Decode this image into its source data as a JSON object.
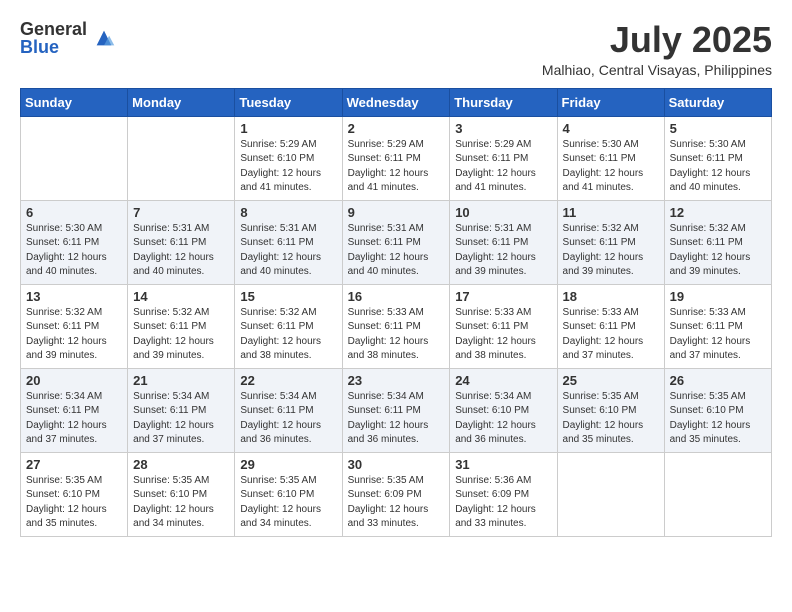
{
  "logo": {
    "general": "General",
    "blue": "Blue"
  },
  "title": {
    "month_year": "July 2025",
    "location": "Malhiao, Central Visayas, Philippines"
  },
  "weekdays": [
    "Sunday",
    "Monday",
    "Tuesday",
    "Wednesday",
    "Thursday",
    "Friday",
    "Saturday"
  ],
  "weeks": [
    [
      {
        "day": "",
        "info": ""
      },
      {
        "day": "",
        "info": ""
      },
      {
        "day": "1",
        "info": "Sunrise: 5:29 AM\nSunset: 6:10 PM\nDaylight: 12 hours and 41 minutes."
      },
      {
        "day": "2",
        "info": "Sunrise: 5:29 AM\nSunset: 6:11 PM\nDaylight: 12 hours and 41 minutes."
      },
      {
        "day": "3",
        "info": "Sunrise: 5:29 AM\nSunset: 6:11 PM\nDaylight: 12 hours and 41 minutes."
      },
      {
        "day": "4",
        "info": "Sunrise: 5:30 AM\nSunset: 6:11 PM\nDaylight: 12 hours and 41 minutes."
      },
      {
        "day": "5",
        "info": "Sunrise: 5:30 AM\nSunset: 6:11 PM\nDaylight: 12 hours and 40 minutes."
      }
    ],
    [
      {
        "day": "6",
        "info": "Sunrise: 5:30 AM\nSunset: 6:11 PM\nDaylight: 12 hours and 40 minutes."
      },
      {
        "day": "7",
        "info": "Sunrise: 5:31 AM\nSunset: 6:11 PM\nDaylight: 12 hours and 40 minutes."
      },
      {
        "day": "8",
        "info": "Sunrise: 5:31 AM\nSunset: 6:11 PM\nDaylight: 12 hours and 40 minutes."
      },
      {
        "day": "9",
        "info": "Sunrise: 5:31 AM\nSunset: 6:11 PM\nDaylight: 12 hours and 40 minutes."
      },
      {
        "day": "10",
        "info": "Sunrise: 5:31 AM\nSunset: 6:11 PM\nDaylight: 12 hours and 39 minutes."
      },
      {
        "day": "11",
        "info": "Sunrise: 5:32 AM\nSunset: 6:11 PM\nDaylight: 12 hours and 39 minutes."
      },
      {
        "day": "12",
        "info": "Sunrise: 5:32 AM\nSunset: 6:11 PM\nDaylight: 12 hours and 39 minutes."
      }
    ],
    [
      {
        "day": "13",
        "info": "Sunrise: 5:32 AM\nSunset: 6:11 PM\nDaylight: 12 hours and 39 minutes."
      },
      {
        "day": "14",
        "info": "Sunrise: 5:32 AM\nSunset: 6:11 PM\nDaylight: 12 hours and 39 minutes."
      },
      {
        "day": "15",
        "info": "Sunrise: 5:32 AM\nSunset: 6:11 PM\nDaylight: 12 hours and 38 minutes."
      },
      {
        "day": "16",
        "info": "Sunrise: 5:33 AM\nSunset: 6:11 PM\nDaylight: 12 hours and 38 minutes."
      },
      {
        "day": "17",
        "info": "Sunrise: 5:33 AM\nSunset: 6:11 PM\nDaylight: 12 hours and 38 minutes."
      },
      {
        "day": "18",
        "info": "Sunrise: 5:33 AM\nSunset: 6:11 PM\nDaylight: 12 hours and 37 minutes."
      },
      {
        "day": "19",
        "info": "Sunrise: 5:33 AM\nSunset: 6:11 PM\nDaylight: 12 hours and 37 minutes."
      }
    ],
    [
      {
        "day": "20",
        "info": "Sunrise: 5:34 AM\nSunset: 6:11 PM\nDaylight: 12 hours and 37 minutes."
      },
      {
        "day": "21",
        "info": "Sunrise: 5:34 AM\nSunset: 6:11 PM\nDaylight: 12 hours and 37 minutes."
      },
      {
        "day": "22",
        "info": "Sunrise: 5:34 AM\nSunset: 6:11 PM\nDaylight: 12 hours and 36 minutes."
      },
      {
        "day": "23",
        "info": "Sunrise: 5:34 AM\nSunset: 6:11 PM\nDaylight: 12 hours and 36 minutes."
      },
      {
        "day": "24",
        "info": "Sunrise: 5:34 AM\nSunset: 6:10 PM\nDaylight: 12 hours and 36 minutes."
      },
      {
        "day": "25",
        "info": "Sunrise: 5:35 AM\nSunset: 6:10 PM\nDaylight: 12 hours and 35 minutes."
      },
      {
        "day": "26",
        "info": "Sunrise: 5:35 AM\nSunset: 6:10 PM\nDaylight: 12 hours and 35 minutes."
      }
    ],
    [
      {
        "day": "27",
        "info": "Sunrise: 5:35 AM\nSunset: 6:10 PM\nDaylight: 12 hours and 35 minutes."
      },
      {
        "day": "28",
        "info": "Sunrise: 5:35 AM\nSunset: 6:10 PM\nDaylight: 12 hours and 34 minutes."
      },
      {
        "day": "29",
        "info": "Sunrise: 5:35 AM\nSunset: 6:10 PM\nDaylight: 12 hours and 34 minutes."
      },
      {
        "day": "30",
        "info": "Sunrise: 5:35 AM\nSunset: 6:09 PM\nDaylight: 12 hours and 33 minutes."
      },
      {
        "day": "31",
        "info": "Sunrise: 5:36 AM\nSunset: 6:09 PM\nDaylight: 12 hours and 33 minutes."
      },
      {
        "day": "",
        "info": ""
      },
      {
        "day": "",
        "info": ""
      }
    ]
  ]
}
